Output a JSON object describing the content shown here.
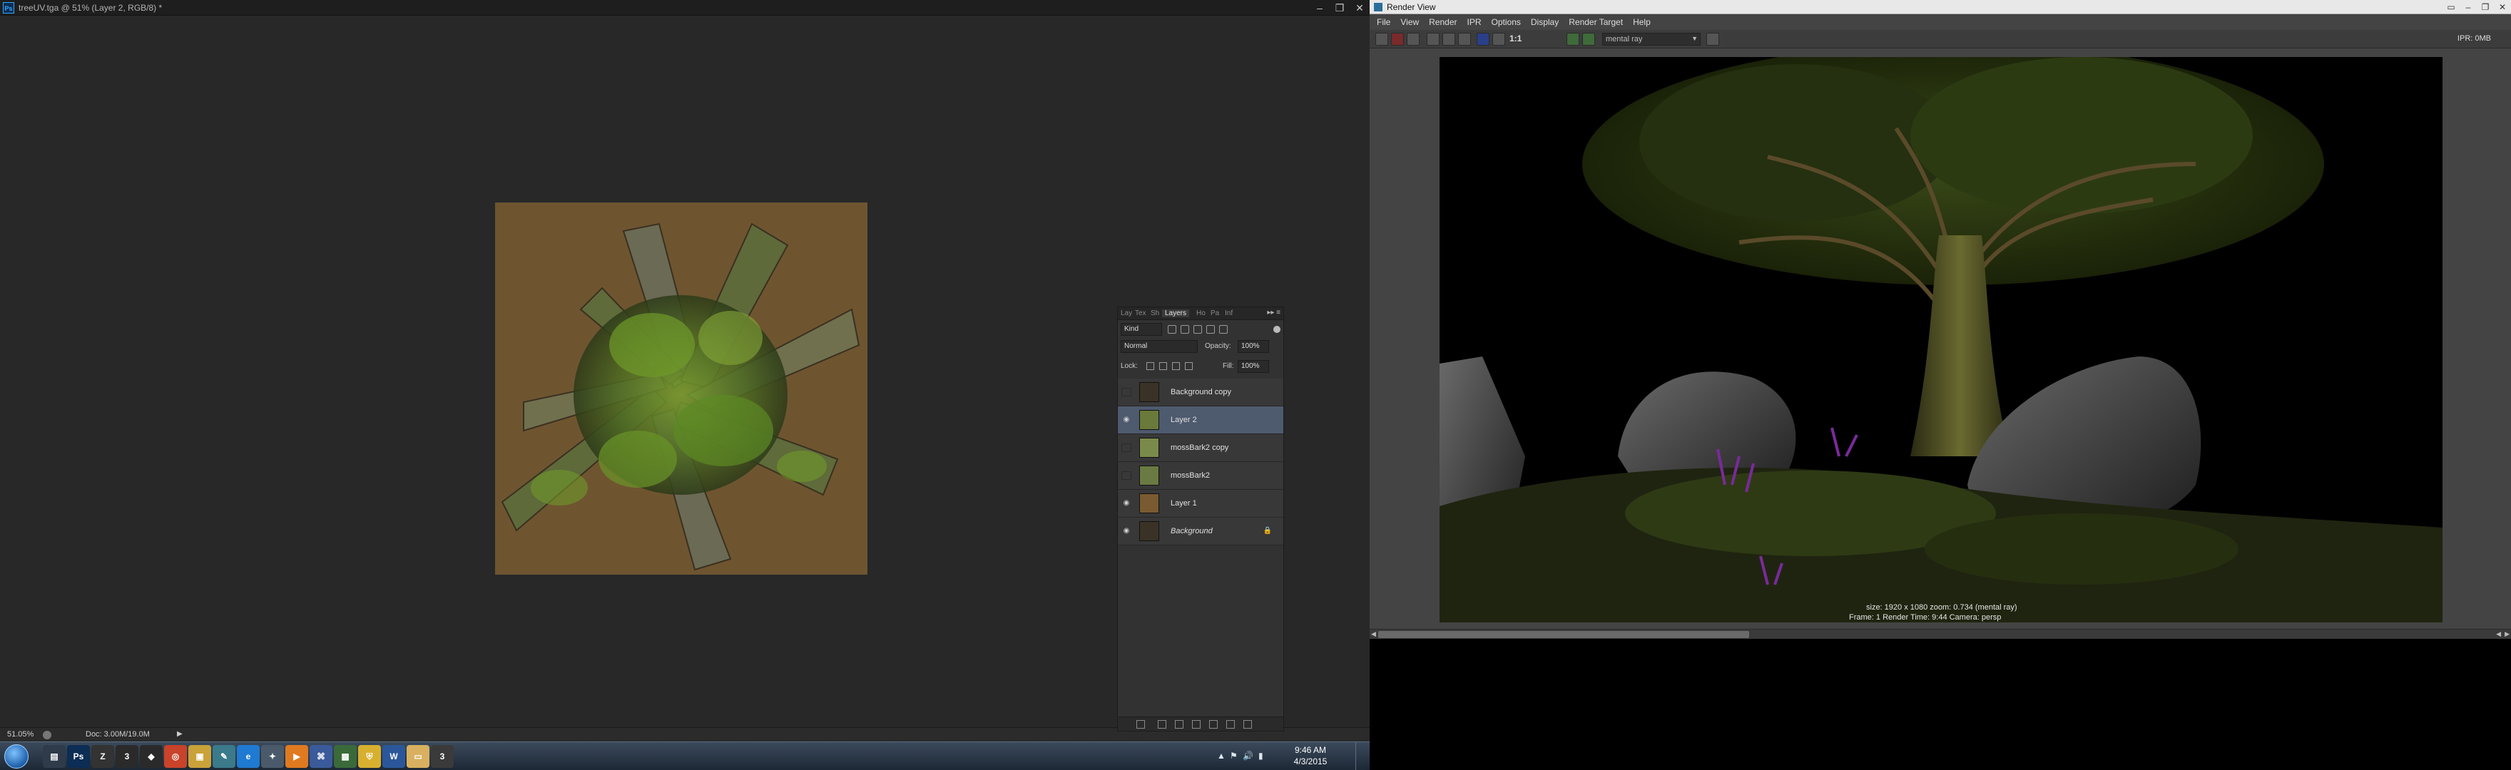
{
  "photoshop": {
    "logo": "Ps",
    "title": "treeUV.tga @ 51% (Layer 2, RGB/8) *",
    "window_controls": {
      "minimize": "–",
      "restore": "❐",
      "close": "✕"
    },
    "status": {
      "zoom": "51.05%",
      "doc_info": "Doc: 3.00M/19.0M",
      "arrow": "▶"
    }
  },
  "layers_panel": {
    "tabs": [
      "Lay",
      "Tex",
      "Sh",
      "Layers",
      "Ho",
      "Pa",
      "Inf"
    ],
    "active_tab": "Layers",
    "menu_glyph": "▸▸ ≡",
    "kind_label": "Kind",
    "blend_mode": "Normal",
    "opacity_label": "Opacity:",
    "opacity_value": "100%",
    "lock_label": "Lock:",
    "fill_label": "Fill:",
    "fill_value": "100%",
    "layers": [
      {
        "name": "Background copy",
        "visible": false,
        "selected": false,
        "thumb_color": "#3a3226",
        "italic": false,
        "locked": false
      },
      {
        "name": "Layer 2",
        "visible": true,
        "selected": true,
        "thumb_color": "#6a7a3a",
        "italic": false,
        "locked": false
      },
      {
        "name": "mossBark2 copy",
        "visible": false,
        "selected": false,
        "thumb_color": "#7a8a4a",
        "italic": false,
        "locked": false
      },
      {
        "name": "mossBark2",
        "visible": false,
        "selected": false,
        "thumb_color": "#6a7a42",
        "italic": false,
        "locked": false
      },
      {
        "name": "Layer 1",
        "visible": true,
        "selected": false,
        "thumb_color": "#7a5a30",
        "italic": false,
        "locked": false
      },
      {
        "name": "Background",
        "visible": true,
        "selected": false,
        "thumb_color": "#3a3226",
        "italic": true,
        "locked": true
      }
    ],
    "eye_glyph": "◉",
    "lock_glyph": "🔒"
  },
  "taskbar": {
    "apps": [
      {
        "name": "file-manager",
        "label": "▤",
        "color": "#2f3b4a"
      },
      {
        "name": "photoshop",
        "label": "Ps",
        "color": "#0c2d54"
      },
      {
        "name": "zbrush",
        "label": "Z",
        "color": "#333333"
      },
      {
        "name": "3dsmax",
        "label": "3",
        "color": "#2a2a2a"
      },
      {
        "name": "unity",
        "label": "◆",
        "color": "#2a2a2a"
      },
      {
        "name": "chrome",
        "label": "◎",
        "color": "#c8432a"
      },
      {
        "name": "explorer-folders",
        "label": "▣",
        "color": "#c9a23a"
      },
      {
        "name": "sketch-tool",
        "label": "✎",
        "color": "#3a7a8a"
      },
      {
        "name": "internet-explorer",
        "label": "e",
        "color": "#1f7ad1"
      },
      {
        "name": "tool-app",
        "label": "✦",
        "color": "#4a5a6a"
      },
      {
        "name": "media-player",
        "label": "▶",
        "color": "#e07a20"
      },
      {
        "name": "network-app",
        "label": "⌘",
        "color": "#3a5a9a"
      },
      {
        "name": "system-app",
        "label": "▦",
        "color": "#3a6a3a"
      },
      {
        "name": "security-app",
        "label": "⛨",
        "color": "#d8b030"
      },
      {
        "name": "word",
        "label": "W",
        "color": "#2b579a"
      },
      {
        "name": "explorer",
        "label": "▭",
        "color": "#d8b060"
      },
      {
        "name": "3ds-max-2015",
        "label": "3",
        "color": "#3a3a3a"
      }
    ],
    "tray": {
      "up_arrow": "▲",
      "flag": "⚑",
      "volume": "🔊",
      "network": "▮"
    },
    "clock": {
      "time": "9:46 AM",
      "date": "4/3/2015"
    }
  },
  "render_view": {
    "title": "Render View",
    "window_controls": {
      "menu": "▭",
      "minimize": "–",
      "restore": "❐",
      "close": "✕"
    },
    "menus": [
      "File",
      "View",
      "Render",
      "IPR",
      "Options",
      "Display",
      "Render Target",
      "Help"
    ],
    "one_to_one": "1:1",
    "renderer": "mental ray",
    "renderer_arrow": "▼",
    "ipr_text": "IPR: 0MB",
    "hud_line1": "size: 1920 x 1080  zoom: 0.734      (mental ray)",
    "hud_line2": "Frame: 1      Render Time: 9:44      Camera: persp"
  },
  "colors": {
    "ps_bg": "#282828",
    "selected_layer": "#4e5a6e",
    "canvas_bg": "#6e5530",
    "render_bg": "#000000"
  }
}
